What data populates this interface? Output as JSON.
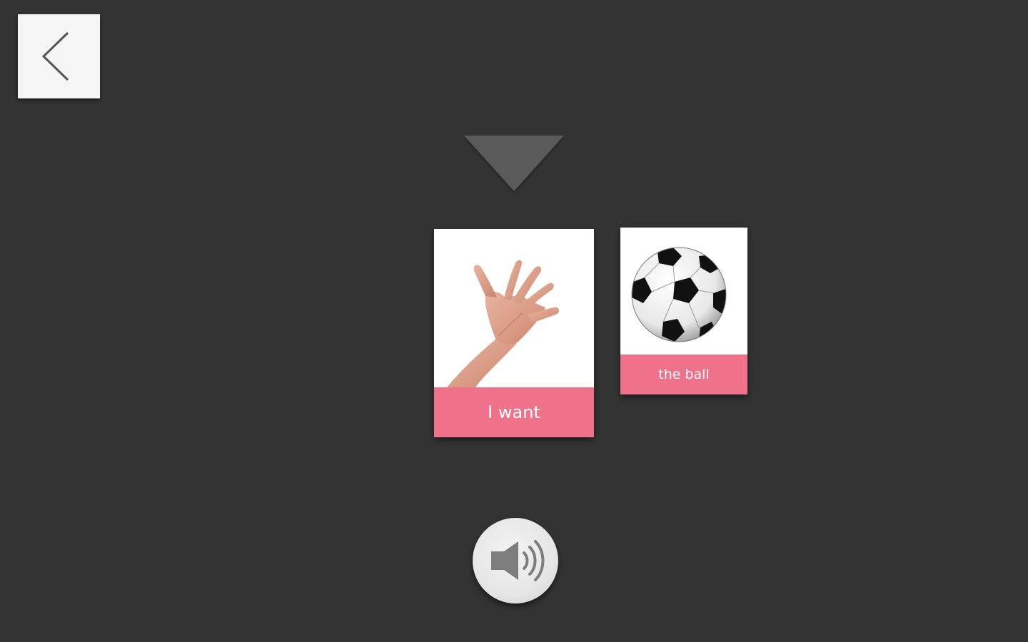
{
  "navigation": {
    "back_icon": "chevron-left-icon"
  },
  "sentence_strip": {
    "pointer_icon": "triangle-down-icon",
    "cards": [
      {
        "label": "I want",
        "picture": "reaching-hand",
        "caption_color": "#f0728a"
      },
      {
        "label": "the ball",
        "picture": "soccer-ball",
        "caption_color": "#f0728a"
      }
    ]
  },
  "controls": {
    "speak_icon": "speaker-icon"
  },
  "colors": {
    "background": "#333333",
    "caption": "#f0728a",
    "card": "#ffffff"
  }
}
